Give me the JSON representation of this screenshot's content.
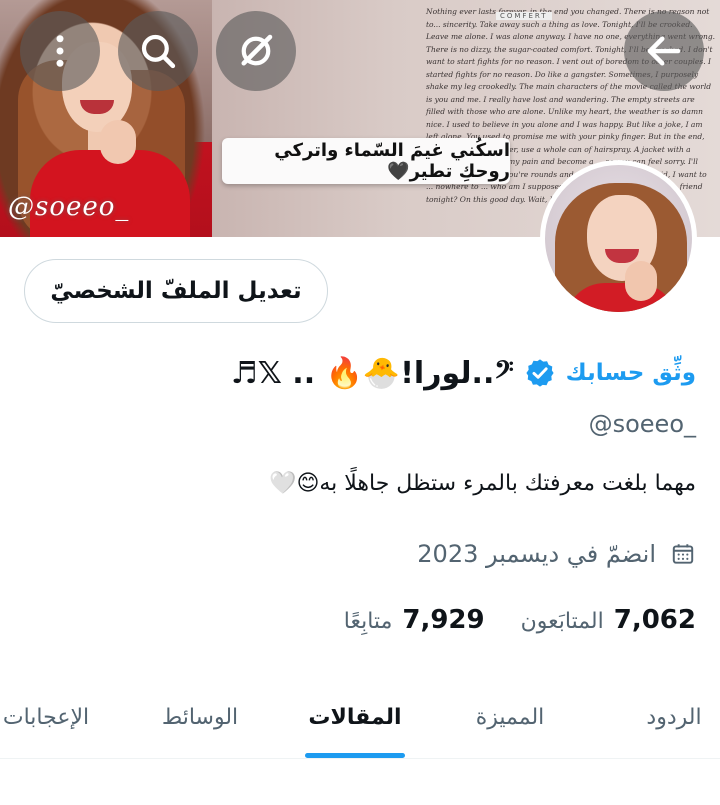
{
  "header": {
    "banner_signature": "@soeeo_",
    "banner_quote": "اسكُني غيمَ السّماء واتركي روحكِ تطير🖤",
    "banner_tag": "COMFERT",
    "banner_text": "Nothing ever lasts forever, in the end you changed. There is no reason not to... sincerity. Take away such a thing as love. Tonight, I'll be crooked. Leave me alone. I was alone anyway. I have no one, everything went wrong. There is no dizzy, the sugar-coated comfort. Tonight, I'll be crooked. I don't want to start fights for no reason. I vent out of boredom to other couples. I started fights for no reason. Do like a gangster. Sometimes, I purposely shake my leg crookedly. The main characters of the movie called the world is you and me. I really have lost and wandering. The empty streets are filled with those who are alone. Unlike my heart, the weather is so damn nice. I used to believe in you alone and I was happy. But like a joke, I am left alone. You used to promise me with your pinky finger. But in the end, I'll put on thick eyeliner, use a whole can of hairspray. A jacket with a frown. I want to hide my pain and become a ... so you can feel sorry. I'll look toward the sky. You're rounds and rounds and ... I'm afraid, I want to ... nowhere to ... who am I supposed to do? I can't turn ... to me ... friend tonight? On this good day. Wait, I don't know being alone ..."
  },
  "buttons": {
    "back_icon": "arrow-left-icon",
    "grok_icon": "slash-circle-icon",
    "search_icon": "search-icon",
    "more_icon": "more-vertical-icon",
    "edit_profile_label": "تعديل الملفّ الشخصيّ"
  },
  "profile": {
    "verify_link": "وثِّق حسابك",
    "display_name": "𝄢..لورا!🐣🔥 .. 𝕏♬",
    "handle": "@soeeo_",
    "bio": "مهما بلغت معرفتك بالمرء  ستظل جاهلًا به😊🤍",
    "joined": "انضمّ في ديسمبر 2023",
    "followers_count": "7,062",
    "followers_label": "المتابَعون",
    "following_count": "7,929",
    "following_label": "متابِعًا"
  },
  "tabs": {
    "replies": "الردود",
    "highlights": "المميزة",
    "posts": "المقالات",
    "media": "الوسائط",
    "likes": "الإعجابات",
    "active": "posts"
  },
  "colors": {
    "accent": "#1d9bf0",
    "text_primary": "#0f1419",
    "text_secondary": "#536471"
  }
}
